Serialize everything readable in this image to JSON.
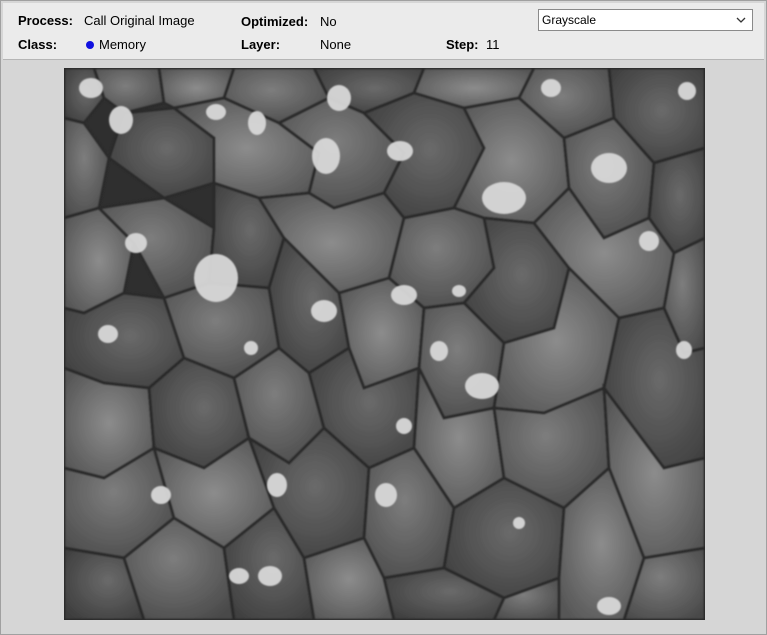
{
  "header": {
    "process_label": "Process:",
    "process_value": "Call Original Image",
    "optimized_label": "Optimized:",
    "optimized_value": "No",
    "class_label": "Class:",
    "class_value": "Memory",
    "class_color": "#1010e0",
    "layer_label": "Layer:",
    "layer_value": "None",
    "step_label": "Step:",
    "step_value": "11"
  },
  "view_select": {
    "selected": "Grayscale",
    "icon": "chevron-down-icon"
  },
  "image": {
    "description_icon": "microstructure-image"
  }
}
